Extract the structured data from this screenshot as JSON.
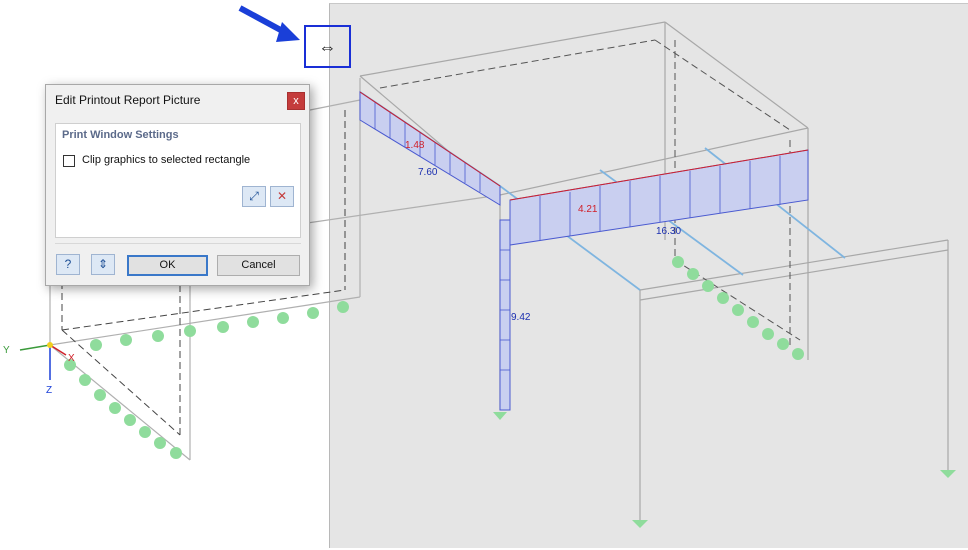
{
  "dialog": {
    "title": "Edit Printout Report Picture",
    "close_label": "x",
    "section_title": "Print Window Settings",
    "clip_label": "Clip graphics to selected rectangle",
    "clip_checked": false,
    "ok_label": "OK",
    "cancel_label": "Cancel"
  },
  "model": {
    "values": [
      "1.48",
      "7.60",
      "4.21",
      "16.30",
      "9.42"
    ],
    "axes": {
      "x": "X",
      "y": "Y",
      "z": "Z"
    }
  },
  "cursor_icon": "horizontal-resize-cursor-icon",
  "colors": {
    "highlight": "#1a2fd6",
    "diagram_fill": "#c9cff0",
    "support": "#7fd690",
    "beam": "#7fb5e0"
  }
}
